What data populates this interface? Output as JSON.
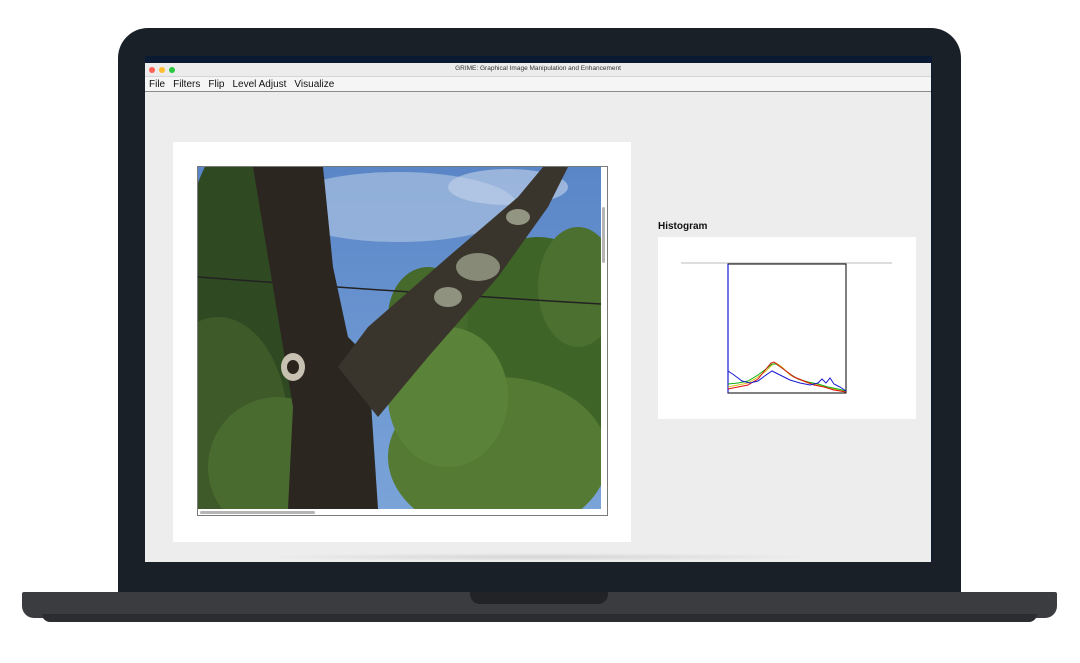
{
  "window": {
    "title": "GRIME: Graphical Image Manipulation and Enhancement"
  },
  "menu": {
    "items": [
      "File",
      "Filters",
      "Flip",
      "Level Adjust",
      "Visualize"
    ]
  },
  "histogram": {
    "label": "Histogram",
    "colors": {
      "red": "#e01010",
      "green": "#10b010",
      "blue": "#1818d0",
      "intensity": "#d8c020"
    }
  },
  "colors": {
    "lid": "#1a2028",
    "window_bg": "#ededed",
    "panel_bg": "#ffffff"
  }
}
